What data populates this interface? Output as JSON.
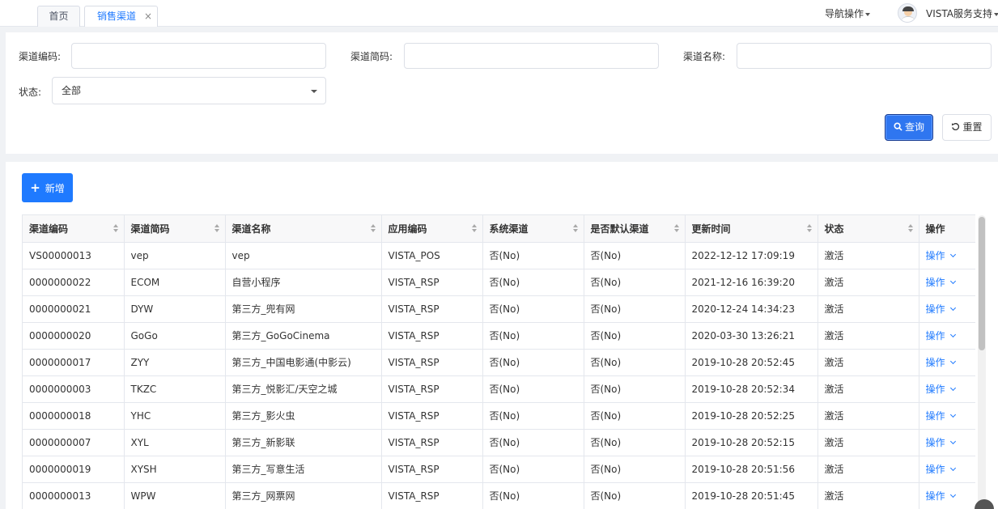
{
  "tabs": [
    {
      "label": "首页"
    },
    {
      "label": "销售渠道",
      "close": "×"
    }
  ],
  "header": {
    "nav_label": "导航操作",
    "user_name": "VISTA服务支持"
  },
  "search": {
    "code_label": "渠道编码:",
    "short_label": "渠道简码:",
    "name_label": "渠道名称:",
    "status_label": "状态:",
    "status_value": "全部",
    "code_value": "",
    "short_value": "",
    "name_value": "",
    "query_label": "查询",
    "reset_label": "重置"
  },
  "toolbar": {
    "add_label": "新增"
  },
  "table": {
    "columns": [
      "渠道编码",
      "渠道简码",
      "渠道名称",
      "应用编码",
      "系统渠道",
      "是否默认渠道",
      "更新时间",
      "状态",
      "操作"
    ],
    "rows": [
      [
        "VS00000013",
        "vep",
        "vep",
        "VISTA_POS",
        "否(No)",
        "否(No)",
        "2022-12-12 17:09:19",
        "激活",
        "操作"
      ],
      [
        "0000000022",
        "ECOM",
        "自营小程序",
        "VISTA_RSP",
        "否(No)",
        "否(No)",
        "2021-12-16 16:39:20",
        "激活",
        "操作"
      ],
      [
        "0000000021",
        "DYW",
        "第三方_兜有网",
        "VISTA_RSP",
        "否(No)",
        "否(No)",
        "2020-12-24 14:34:23",
        "激活",
        "操作"
      ],
      [
        "0000000020",
        "GoGo",
        "第三方_GoGoCinema",
        "VISTA_RSP",
        "否(No)",
        "否(No)",
        "2020-03-30 13:26:21",
        "激活",
        "操作"
      ],
      [
        "0000000017",
        "ZYY",
        "第三方_中国电影通(中影云)",
        "VISTA_RSP",
        "否(No)",
        "否(No)",
        "2019-10-28 20:52:45",
        "激活",
        "操作"
      ],
      [
        "0000000003",
        "TKZC",
        "第三方_悦影汇/天空之城",
        "VISTA_RSP",
        "否(No)",
        "否(No)",
        "2019-10-28 20:52:34",
        "激活",
        "操作"
      ],
      [
        "0000000018",
        "YHC",
        "第三方_影火虫",
        "VISTA_RSP",
        "否(No)",
        "否(No)",
        "2019-10-28 20:52:25",
        "激活",
        "操作"
      ],
      [
        "0000000007",
        "XYL",
        "第三方_新影联",
        "VISTA_RSP",
        "否(No)",
        "否(No)",
        "2019-10-28 20:52:15",
        "激活",
        "操作"
      ],
      [
        "0000000019",
        "XYSH",
        "第三方_写意生活",
        "VISTA_RSP",
        "否(No)",
        "否(No)",
        "2019-10-28 20:51:56",
        "激活",
        "操作"
      ],
      [
        "0000000013",
        "WPW",
        "第三方_网票网",
        "VISTA_RSP",
        "否(No)",
        "否(No)",
        "2019-10-28 20:51:45",
        "激活",
        "操作"
      ]
    ]
  }
}
